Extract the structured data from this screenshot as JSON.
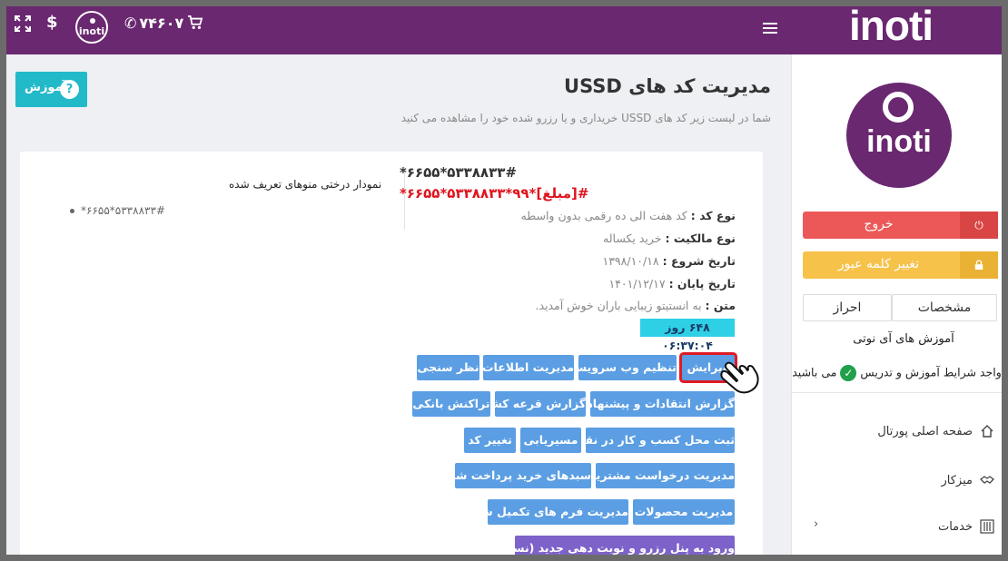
{
  "topbar": {
    "brand": "inoti",
    "logo_small": "inoti",
    "phone": "۷۴۶۰۷",
    "icons": [
      "expand-icon",
      "dollar-icon",
      "phone-icon",
      "cart-icon",
      "hamburger-icon"
    ],
    "dollar": "$"
  },
  "sidebar": {
    "avatar_text": "inoti",
    "logout": "خروج",
    "change_password": "تغییر کلمه عبور",
    "tabs": [
      "مشخصات",
      "احراز"
    ],
    "training_title": "آموزش های آی نوتی",
    "terms_before": "واجد شرایط آموزش و تدریس",
    "terms_after": "می باشید",
    "nav": [
      {
        "label": "صفحه اصلی پورتال",
        "icon": "home-icon"
      },
      {
        "label": "میزکار",
        "icon": "handshake-icon"
      },
      {
        "label": "خدمات",
        "icon": "services-icon"
      }
    ]
  },
  "main": {
    "help_button": "آموزش",
    "title": "مدیریت کد های USSD",
    "subtitle": "شما در لیست زیر کد های USSD خریداری و یا رزرو شده خود را مشاهده می کنید",
    "tree_title": "نمودار درختی منوهای تعریف شده",
    "tree_item": "*۶۶۵۵*۵۳۳۸۸۳۳#",
    "code_main": "*۶۶۵۵*۵۳۳۸۸۳۳#",
    "code_amount": "*۶۶۵۵*۵۳۳۸۸۳۳*۹۹*[مبلغ]#",
    "info": [
      {
        "label": "نوع کد :",
        "value": "کد هفت الی ده رقمی بدون واسطه"
      },
      {
        "label": "نوع مالکیت :",
        "value": "خرید یکساله"
      },
      {
        "label": "تاریخ شروع :",
        "value": "۱۳۹۸/۱۰/۱۸"
      },
      {
        "label": "تاریخ پایان :",
        "value": "۱۴۰۱/۱۲/۱۷"
      },
      {
        "label": "متن :",
        "value": "به انستیتو زیبایی باران خوش آمدید."
      }
    ],
    "timer": "۶۴۸ روز ۰۶:۳۷:۰۴",
    "buttons": {
      "edit": "ویرایش",
      "webservice": "تنظیم وب سرویس",
      "info_mgmt": "مدیریت اطلاعات",
      "survey": "نظر سنجی",
      "criticism_report": "گزارش انتقادات و پیشنهادات",
      "lottery_report": "گزارش قرعه کشی",
      "bank_tx": "تراکنش بانکی",
      "map_register": "ثبت محل کسب و کار در نقشه",
      "routing": "مسیریابی",
      "change_code": "تغییر کد",
      "customer_requests": "مدیریت درخواست مشتریان",
      "paid_carts": "سبدهای خرید پرداخت شده",
      "products": "مدیریت محصولات",
      "forms": "مدیریت فرم های تکمیل شده",
      "booking_panel": "ورود به پنل رزرو و نوبت دهی جدید (نسخه بتا)"
    }
  }
}
